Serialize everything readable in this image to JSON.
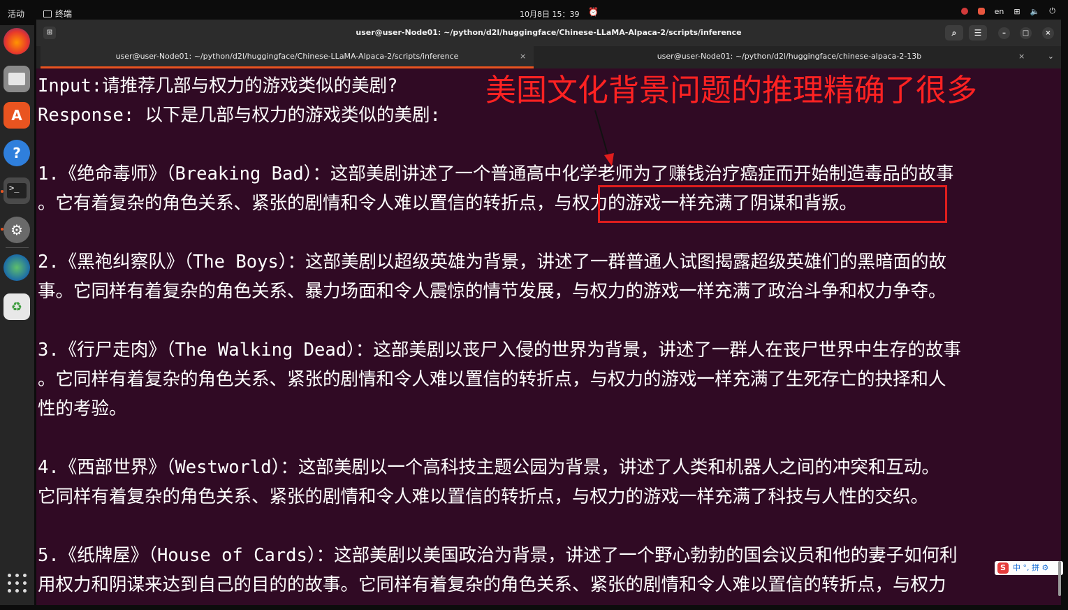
{
  "topbar": {
    "activities": "活动",
    "app_name": "终端",
    "clock": "10月8日 15：39",
    "lang": "en"
  },
  "dock": {
    "items": [
      "firefox-icon",
      "files-icon",
      "software-icon",
      "help-icon",
      "terminal-icon",
      "settings-icon",
      "globe-icon",
      "trash-icon"
    ],
    "apps_grid": "show-applications-icon"
  },
  "window": {
    "title": "user@user-Node01: ~/python/d2l/huggingface/Chinese-LLaMA-Alpaca-2/scripts/inference",
    "tabs": [
      {
        "label": "user@user-Node01: ~/python/d2l/huggingface/Chinese-LLaMA-Alpaca-2/scripts/inference",
        "active": true
      },
      {
        "label": "user@user-Node01: ~/python/d2l/huggingface/chinese-alpaca-2-13b",
        "active": false
      }
    ]
  },
  "terminal": {
    "lines": [
      "Input:请推荐几部与权力的游戏类似的美剧?",
      "Response:  以下是几部与权力的游戏类似的美剧:",
      "",
      "1.《绝命毒师》（Breaking Bad）：这部美剧讲述了一个普通高中化学老师为了赚钱治疗癌症而开始制造毒品的故事",
      "。它有着复杂的角色关系、紧张的剧情和令人难以置信的转折点，与权力的游戏一样充满了阴谋和背叛。",
      "",
      "2.《黑袍纠察队》（The Boys）：这部美剧以超级英雄为背景，讲述了一群普通人试图揭露超级英雄们的黑暗面的故",
      "事。它同样有着复杂的角色关系、暴力场面和令人震惊的情节发展，与权力的游戏一样充满了政治斗争和权力争夺。",
      "",
      "3.《行尸走肉》（The Walking Dead）：这部美剧以丧尸入侵的世界为背景，讲述了一群人在丧尸世界中生存的故事",
      "。它同样有着复杂的角色关系、紧张的剧情和令人难以置信的转折点，与权力的游戏一样充满了生死存亡的抉择和人",
      "性的考验。",
      "",
      "",
      "4.《西部世界》（Westworld）：这部美剧以一个高科技主题公园为背景，讲述了人类和机器人之间的冲突和互动。",
      "它同样有着复杂的角色关系、紧张的剧情和令人难以置信的转折点，与权力的游戏一样充满了科技与人性的交织。",
      "",
      "",
      "5.《纸牌屋》（House of Cards）：这部美剧以美国政治为背景，讲述了一个野心勃勃的国会议员和他的妻子如何利",
      "用权力和阴谋来达到自己的目的的故事。它同样有着复杂的角色关系、紧张的剧情和令人难以置信的转折点，与权力"
    ]
  },
  "annotation": {
    "text": "美国文化背景问题的推理精确了很多",
    "color": "#ff2222"
  },
  "ime": {
    "logo": "S",
    "mode": "中 °, 拼 ⚙"
  },
  "colors": {
    "terminal_bg": "#300a24",
    "accent": "#e95420"
  }
}
